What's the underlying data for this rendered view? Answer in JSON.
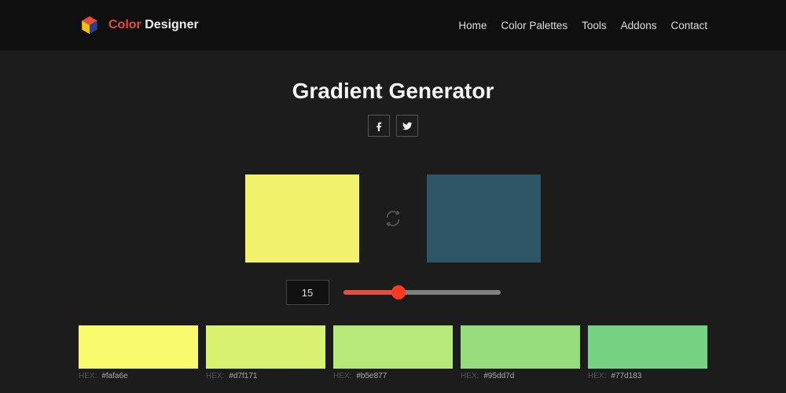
{
  "brand": {
    "first": "Color",
    "second": "Designer"
  },
  "nav": {
    "home": "Home",
    "palettes": "Color Palettes",
    "tools": "Tools",
    "addons": "Addons",
    "contact": "Contact"
  },
  "page": {
    "title": "Gradient Generator"
  },
  "swatches": {
    "left_color": "#f1f16c",
    "right_color": "#2e5565"
  },
  "slider": {
    "steps": "15",
    "fill_pct": "35%"
  },
  "results": {
    "label": "HEX:",
    "items": [
      {
        "hex": "#fafa6e",
        "color": "#fafa6e"
      },
      {
        "hex": "#d7f171",
        "color": "#d7f171"
      },
      {
        "hex": "#b5e877",
        "color": "#b5e877"
      },
      {
        "hex": "#95dd7d",
        "color": "#95dd7d"
      },
      {
        "hex": "#77d183",
        "color": "#77d183"
      }
    ]
  }
}
